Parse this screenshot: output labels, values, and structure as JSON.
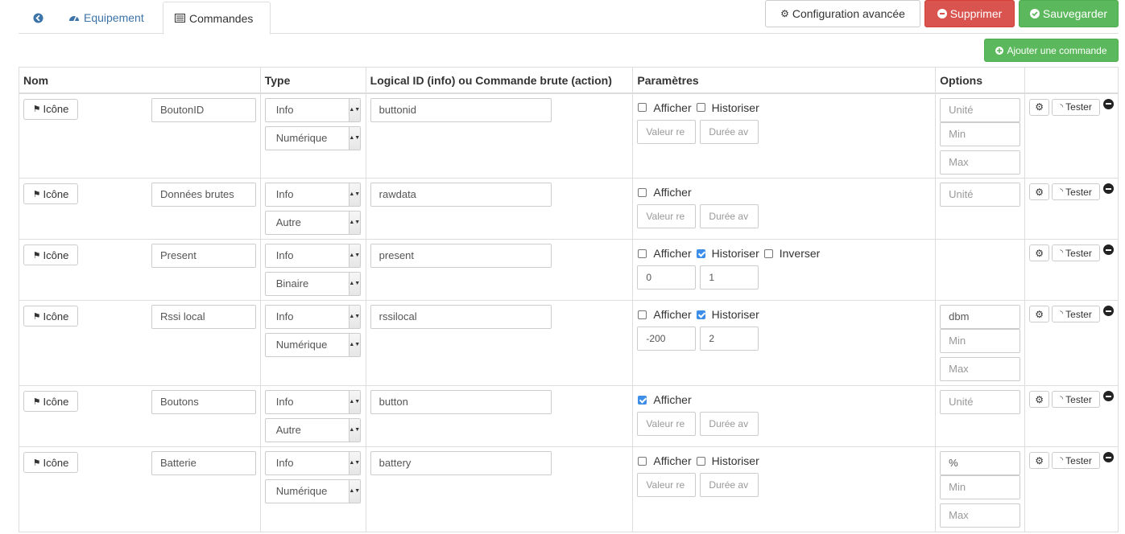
{
  "tabs": {
    "back_icon": "arrow-circle-left-icon",
    "equipement": "Equipement",
    "commandes": "Commandes"
  },
  "buttons": {
    "config": "Configuration avancée",
    "delete": "Supprimer",
    "save": "Sauvegarder",
    "add_command": "Ajouter une commande"
  },
  "colors": {
    "danger": "#d9534f",
    "success": "#5cb85c",
    "link": "#3c73a8",
    "checkbox_on": "#3d8ee8"
  },
  "table": {
    "headers": {
      "nom": "Nom",
      "type": "Type",
      "logical": "Logical ID (info) ou Commande brute (action)",
      "params": "Paramètres",
      "options": "Options"
    },
    "icon_label": "Icône",
    "test_label": "Tester",
    "afficher": "Afficher",
    "historiser": "Historiser",
    "inverser": "Inverser",
    "unite_ph": "Unité",
    "min_ph": "Min",
    "max_ph": "Max",
    "valeur_ph": "Valeur re",
    "duree_ph": "Durée av",
    "rows": [
      {
        "name": "BoutonID",
        "type": "Info",
        "subtype": "Numérique",
        "logical": "buttonid",
        "afficher": false,
        "historiser": false,
        "unite": "",
        "min": "",
        "max": ""
      },
      {
        "name": "Données brutes",
        "type": "Info",
        "subtype": "Autre",
        "logical": "rawdata",
        "afficher": false,
        "unite": ""
      },
      {
        "name": "Present",
        "type": "Info",
        "subtype": "Binaire",
        "logical": "present",
        "afficher": false,
        "historiser": true,
        "inverser": false,
        "val1": "0",
        "val2": "1"
      },
      {
        "name": "Rssi local",
        "type": "Info",
        "subtype": "Numérique",
        "logical": "rssilocal",
        "afficher": false,
        "historiser": true,
        "val1": "-200",
        "val2": "2",
        "unite": "dbm",
        "min": "",
        "max": ""
      },
      {
        "name": "Boutons",
        "type": "Info",
        "subtype": "Autre",
        "logical": "button",
        "afficher": true,
        "unite": ""
      },
      {
        "name": "Batterie",
        "type": "Info",
        "subtype": "Numérique",
        "logical": "battery",
        "afficher": false,
        "historiser": false,
        "unite": "%",
        "min": "",
        "max": ""
      }
    ]
  }
}
